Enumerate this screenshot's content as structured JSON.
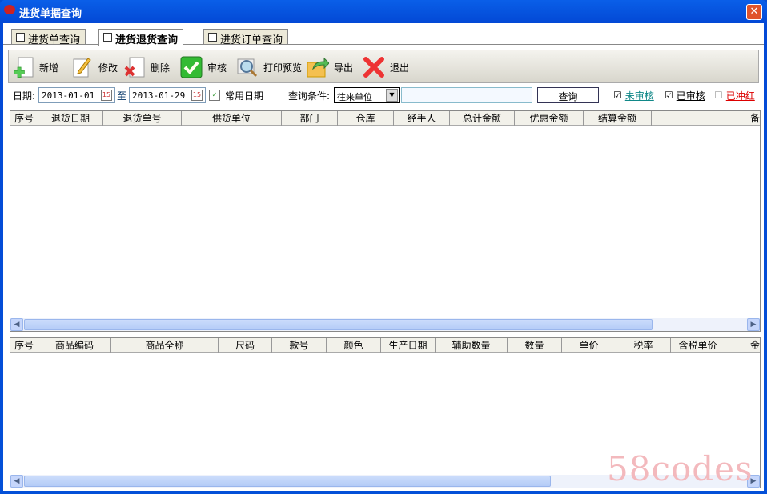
{
  "window": {
    "title": "进货单据查询",
    "close": "✕"
  },
  "tabs": [
    {
      "label": "进货单查询"
    },
    {
      "label": "进货退货查询",
      "active": true
    },
    {
      "label": "进货订单查询"
    }
  ],
  "toolbar": {
    "add": "新增",
    "edit": "修改",
    "delete": "删除",
    "audit": "审核",
    "print_preview": "打印预览",
    "export": "导出",
    "exit": "退出"
  },
  "filter": {
    "date_label": "日期:",
    "date_from": "2013-01-01",
    "to_label": "至",
    "date_to": "2013-01-29",
    "common_dates": "常用日期",
    "condition_label": "查询条件:",
    "condition_value": "往来单位",
    "search_value": "",
    "query_button": "查询",
    "unaudited": "未审核",
    "audited": "已审核",
    "reversed": "已冲红",
    "cal_glyph": "15"
  },
  "grid1": {
    "columns": [
      "序号",
      "退货日期",
      "退货单号",
      "供货单位",
      "部门",
      "仓库",
      "经手人",
      "总计金额",
      "优惠金额",
      "结算金额",
      "备"
    ]
  },
  "grid2": {
    "columns": [
      "序号",
      "商品编码",
      "商品全称",
      "尺码",
      "款号",
      "颜色",
      "生产日期",
      "辅助数量",
      "数量",
      "单价",
      "税率",
      "含税单价",
      "金"
    ]
  },
  "watermark": "58codes"
}
